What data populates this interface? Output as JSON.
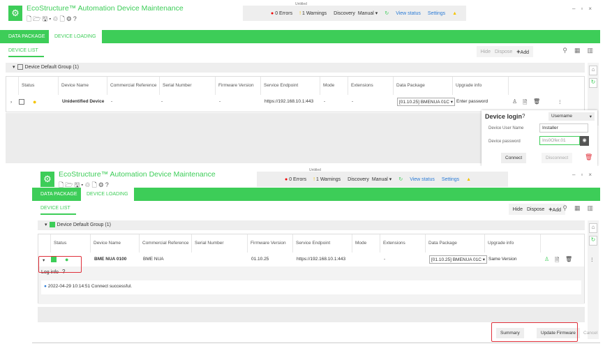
{
  "colors": {
    "brand": "#3dcd58",
    "error": "#e00000",
    "warning": "#f5c400",
    "link": "#2b7bd6",
    "highlight": "#e0303a"
  },
  "windows": [
    {
      "app_title": "EcoStructure™ Automation Device Maintenance",
      "project": "Untitled",
      "errors": "0 Errors",
      "warnings": "1 Warnings",
      "discovery_label": "Discovery",
      "discovery_value": "Manual",
      "view_status": "View status",
      "settings": "Settings",
      "tabs": [
        "DATA PACKAGE",
        "DEVICE LOADING"
      ],
      "active_tab": 1,
      "subtab": "DEVICE LIST",
      "toolbar": {
        "hide": "Hide",
        "dispose": "Dispose",
        "add": "Add",
        "hide_enabled": false
      },
      "group": {
        "label": "Device Default Group (1)",
        "checked": false
      },
      "columns": [
        "",
        "Status",
        "Device Name",
        "Commercial Reference",
        "Serial Number",
        "Firmware Version",
        "Service Endpoint",
        "Mode",
        "Extensions",
        "Data Package",
        "Upgrade info"
      ],
      "row": {
        "checked": false,
        "status": "warning",
        "name": "Unidentified Device",
        "ref": "-",
        "serial": "-",
        "fw": "-",
        "endpoint": "https://192.168.10.1:443",
        "mode": "-",
        "ext": "-",
        "package": "[01.10.25] BMENUA 01C",
        "upgrade": "Enter password"
      },
      "login": {
        "title": "Device login",
        "mode": "Username",
        "user_label": "Device User Name",
        "user_value": "Installer",
        "pw_label": "Device password",
        "pw_value": "Ins0Ofer.01",
        "connect": "Connect",
        "disconnect": "Disconnect"
      }
    },
    {
      "app_title": "EcoStructure™ Automation Device Maintenance",
      "project": "Untitled",
      "errors": "0 Errors",
      "warnings": "1 Warnings",
      "discovery_label": "Discovery",
      "discovery_value": "Manual",
      "view_status": "View status",
      "settings": "Settings",
      "tabs": [
        "DATA PACKAGE",
        "DEVICE LOADING"
      ],
      "active_tab": 1,
      "subtab": "DEVICE LIST",
      "toolbar": {
        "hide": "Hide",
        "dispose": "Dispose",
        "add": "Add",
        "hide_enabled": true
      },
      "group": {
        "label": "Device Default Group (1)",
        "checked": true
      },
      "columns": [
        "",
        "Status",
        "Device Name",
        "Commercial Reference",
        "Serial Number",
        "Firmware Version",
        "Service Endpoint",
        "Mode",
        "Extensions",
        "Data Package",
        "Upgrade info"
      ],
      "row": {
        "checked": true,
        "status": "ok",
        "name": "BME NUA 0100",
        "ref": "BME NUA",
        "serial": "",
        "fw": "01.10.25",
        "endpoint": "https://192.168.10.1:443",
        "mode": "",
        "ext": "-",
        "package": "[01.10.25] BMENUA 01C",
        "upgrade": "Same Version"
      },
      "log": {
        "title": "Log info",
        "entry": "2022-04-29 10:14:51 Connect successful."
      },
      "footer": {
        "summary": "Summary",
        "update": "Update Firmware",
        "cancel": "Cancel"
      }
    }
  ]
}
